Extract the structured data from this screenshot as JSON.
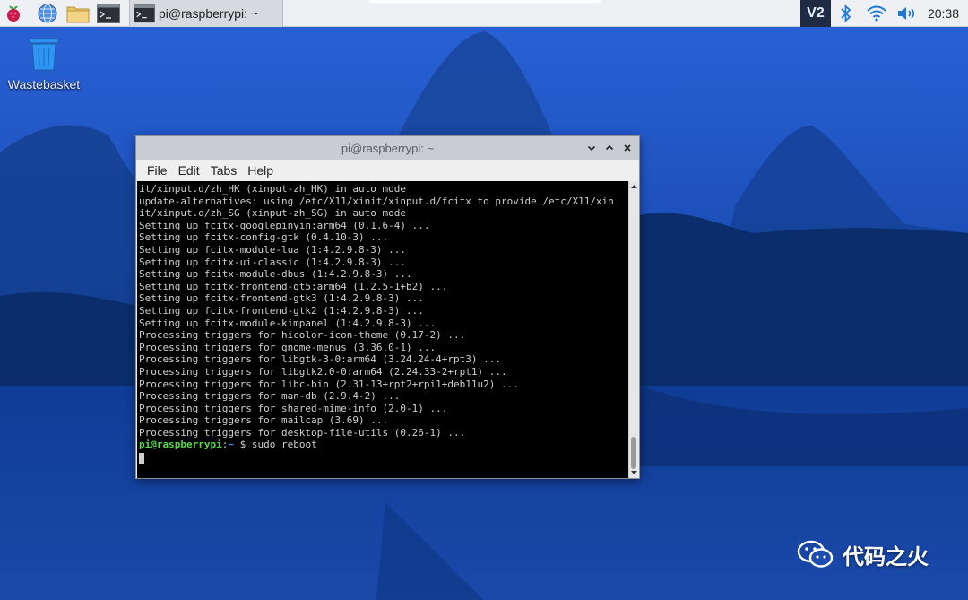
{
  "taskbar": {
    "launchers": [
      {
        "name": "raspberry-menu-icon"
      },
      {
        "name": "web-browser-icon"
      },
      {
        "name": "file-manager-icon"
      },
      {
        "name": "terminal-icon"
      }
    ],
    "task": {
      "label": "pi@raspberrypi: ~"
    },
    "tray": {
      "vnc_label": "V2",
      "clock": "20:38"
    }
  },
  "desktop": {
    "icons": [
      {
        "label": "Wastebasket"
      }
    ]
  },
  "window": {
    "title": "pi@raspberrypi: ~",
    "menu": [
      "File",
      "Edit",
      "Tabs",
      "Help"
    ],
    "terminal": {
      "lines": [
        "it/xinput.d/zh_HK (xinput-zh_HK) in auto mode",
        "update-alternatives: using /etc/X11/xinit/xinput.d/fcitx to provide /etc/X11/xin",
        "it/xinput.d/zh_SG (xinput-zh_SG) in auto mode",
        "Setting up fcitx-googlepinyin:arm64 (0.1.6-4) ...",
        "Setting up fcitx-config-gtk (0.4.10-3) ...",
        "Setting up fcitx-module-lua (1:4.2.9.8-3) ...",
        "Setting up fcitx-ui-classic (1:4.2.9.8-3) ...",
        "Setting up fcitx-module-dbus (1:4.2.9.8-3) ...",
        "Setting up fcitx-frontend-qt5:arm64 (1.2.5-1+b2) ...",
        "Setting up fcitx-frontend-gtk3 (1:4.2.9.8-3) ...",
        "Setting up fcitx-frontend-gtk2 (1:4.2.9.8-3) ...",
        "Setting up fcitx-module-kimpanel (1:4.2.9.8-3) ...",
        "Processing triggers for hicolor-icon-theme (0.17-2) ...",
        "Processing triggers for gnome-menus (3.36.0-1) ...",
        "Processing triggers for libgtk-3-0:arm64 (3.24.24-4+rpt3) ...",
        "Processing triggers for libgtk2.0-0:arm64 (2.24.33-2+rpt1) ...",
        "Processing triggers for libc-bin (2.31-13+rpt2+rpi1+deb11u2) ...",
        "Processing triggers for man-db (2.9.4-2) ...",
        "Processing triggers for shared-mime-info (2.0-1) ...",
        "Processing triggers for mailcap (3.69) ...",
        "Processing triggers for desktop-file-utils (0.26-1) ..."
      ],
      "prompt": {
        "user": "pi@raspberrypi",
        "sep": ":",
        "path": "~",
        "symbol": " $ ",
        "command": "sudo reboot"
      }
    }
  },
  "watermark": {
    "text": "代码之火"
  },
  "colors": {
    "prompt_user": "#55d84a",
    "prompt_path": "#5c8cff",
    "accent": "#1c4bb0"
  }
}
